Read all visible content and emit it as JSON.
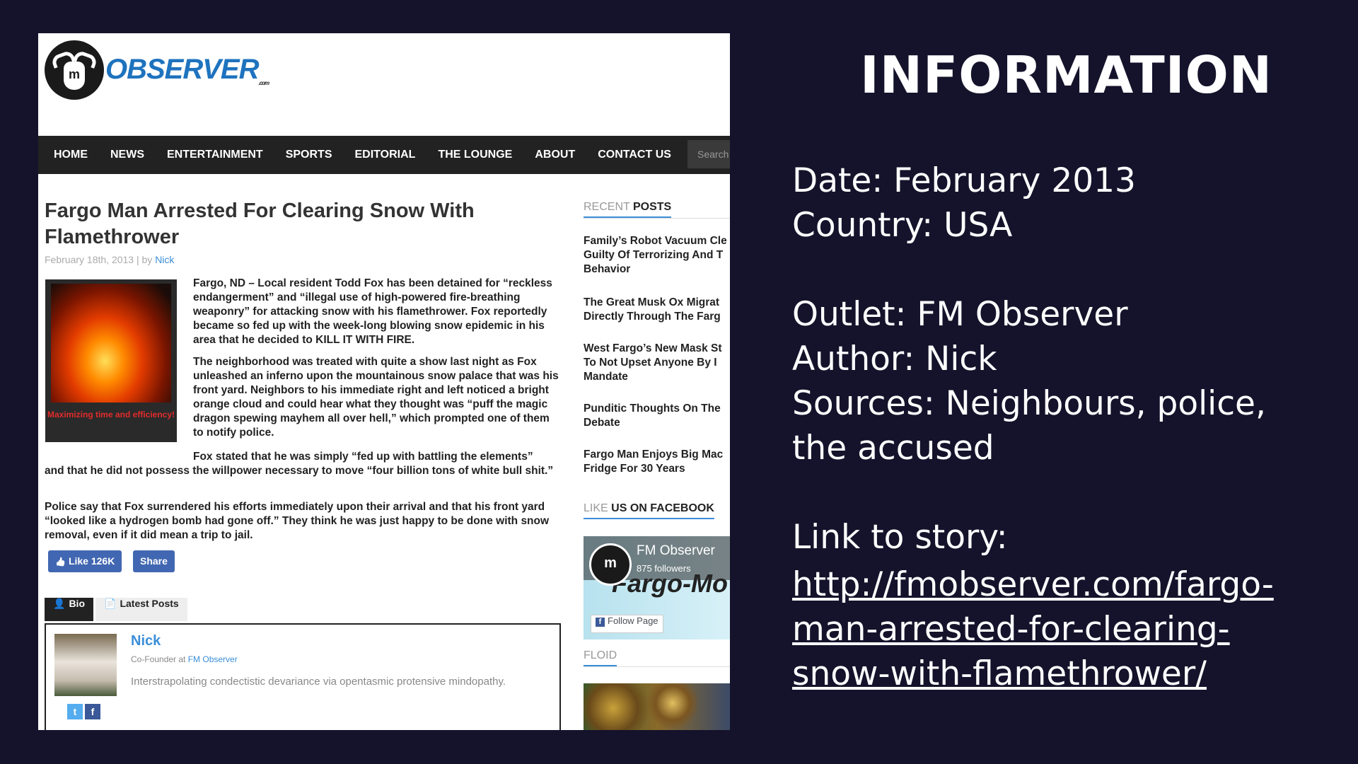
{
  "article_screenshot": {
    "logo_text": "OBSERVER",
    "logo_suffix": ".com",
    "nav": [
      "HOME",
      "NEWS",
      "ENTERTAINMENT",
      "SPORTS",
      "EDITORIAL",
      "THE LOUNGE",
      "ABOUT",
      "CONTACT US"
    ],
    "search_placeholder": "Search",
    "title": "Fargo Man Arrested For Clearing Snow With Flamethrower",
    "date": "February 18th, 2013",
    "by": "| by",
    "author": "Nick",
    "image_caption": "Maximizing time and efficiency!",
    "paragraphs": {
      "p1": "Fargo, ND – Local resident Todd Fox has been detained for “reckless endangerment” and “illegal use of high-powered fire-breathing weaponry” for attacking snow with his flamethrower. Fox reportedly became so fed up with the week-long blowing snow epidemic in his area that he decided to KILL IT WITH FIRE.",
      "p2": "The neighborhood was treated with quite a show last night as Fox unleashed an inferno upon the mountainous snow palace that was his front yard. Neighbors to his immediate right and left noticed a bright orange cloud and could hear what they thought was “puff the magic dragon spewing mayhem all over hell,” which prompted one of them to notify police.",
      "p3a": "Fox stated that he was simply “fed up with battling the elements”",
      "p3b": "and that he did not possess the willpower necessary to move “four billion tons of white bull shit.”",
      "p4": "Police say that Fox surrendered his efforts immediately upon their arrival and that his front yard “looked like a hydrogen bomb had gone off.” They think he was just happy to be done with snow removal, even if it did mean a trip to jail."
    },
    "like_label": "Like 126K",
    "share_label": "Share",
    "tabs": {
      "bio": "Bio",
      "latest": "Latest Posts"
    },
    "bio": {
      "name": "Nick",
      "role_prefix": "Co-Founder at",
      "role_org": "FM Observer",
      "description": "Interstrapolating condectistic devariance via opentasmic protensive mindopathy."
    },
    "sidebar": {
      "recent_prefix": "RECENT",
      "recent_bold": "POSTS",
      "recent_posts": [
        [
          "Family’s Robot Vacuum Cle",
          "Guilty Of Terrorizing And T",
          "Behavior"
        ],
        [
          "The Great Musk Ox Migrat",
          "Directly Through The Farg"
        ],
        [
          "West Fargo’s New Mask St",
          "To Not Upset Anyone By I",
          "Mandate"
        ],
        [
          "Punditic Thoughts On The",
          "Debate"
        ],
        [
          "Fargo Man Enjoys Big Mac",
          "Fridge For 30 Years"
        ]
      ],
      "facebook_prefix": "LIKE",
      "facebook_bold": "US ON FACEBOOK",
      "fb_page_name": "FM Observer",
      "fb_followers": "875 followers",
      "fb_cover_text": "Fargo-Mo",
      "fb_follow_label": "Follow Page",
      "floid_label": "FLOID"
    }
  },
  "information": {
    "heading": "INFORMATION",
    "date": "Date: February 2013",
    "country": "Country: USA",
    "outlet": "Outlet: FM Observer",
    "author": "Author: Nick",
    "sources": "Sources: Neighbours, police,",
    "sources_cont": "the accused",
    "link_label": "Link to story:",
    "link_url": "http://fmobserver.com/fargo-man-arrested-for-clearing-snow-with-flamethrower/"
  }
}
